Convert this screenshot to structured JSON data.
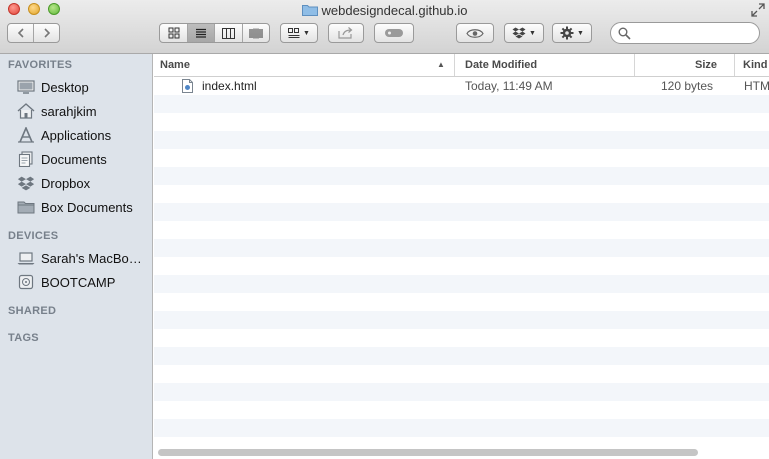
{
  "window": {
    "title": "webdesigndecal.github.io"
  },
  "toolbar": {
    "view_modes": [
      "icon-view",
      "list-view",
      "column-view",
      "coverflow-view"
    ],
    "active_view": "list-view",
    "search": {
      "value": "",
      "placeholder": ""
    }
  },
  "sidebar": {
    "favorites_header": "FAVORITES",
    "favorites": [
      {
        "label": "Desktop",
        "icon": "desktop-icon"
      },
      {
        "label": "sarahjkim",
        "icon": "home-icon"
      },
      {
        "label": "Applications",
        "icon": "applications-icon"
      },
      {
        "label": "Documents",
        "icon": "documents-icon"
      },
      {
        "label": "Dropbox",
        "icon": "dropbox-icon"
      },
      {
        "label": "Box Documents",
        "icon": "folder-icon"
      }
    ],
    "devices_header": "DEVICES",
    "devices": [
      {
        "label": "Sarah's MacBo…",
        "icon": "laptop-icon"
      },
      {
        "label": "BOOTCAMP",
        "icon": "disk-icon"
      }
    ],
    "shared_header": "SHARED",
    "tags_header": "TAGS"
  },
  "list": {
    "columns": {
      "name": "Name",
      "date_modified": "Date Modified",
      "size": "Size",
      "kind": "Kind"
    },
    "sort_indicator": "▲",
    "rows": [
      {
        "name": "index.html",
        "date_modified": "Today, 11:49 AM",
        "size": "120 bytes",
        "kind": "HTM"
      }
    ]
  },
  "colors": {
    "sidebar_bg": "#dde3ea",
    "row_alt": "#f3f6fa",
    "section_header": "#77808b"
  }
}
